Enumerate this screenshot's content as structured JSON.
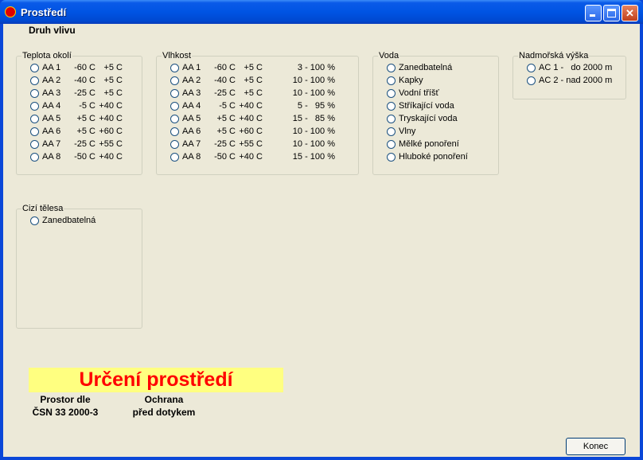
{
  "window": {
    "title": "Prostředí"
  },
  "section_heading": "Druh vlivu",
  "teplota": {
    "legend": "Teplota okolí",
    "items": [
      {
        "code": "AA 1",
        "lo": "-60 C",
        "hi": "+5 C"
      },
      {
        "code": "AA 2",
        "lo": "-40 C",
        "hi": "+5 C"
      },
      {
        "code": "AA 3",
        "lo": "-25 C",
        "hi": "+5 C"
      },
      {
        "code": "AA 4",
        "lo": "-5 C",
        "hi": "+40 C"
      },
      {
        "code": "AA 5",
        "lo": "+5 C",
        "hi": "+40 C"
      },
      {
        "code": "AA 6",
        "lo": "+5 C",
        "hi": "+60 C"
      },
      {
        "code": "AA 7",
        "lo": "-25 C",
        "hi": "+55 C"
      },
      {
        "code": "AA 8",
        "lo": "-50 C",
        "hi": "+40 C"
      }
    ]
  },
  "vlhkost": {
    "legend": "Vlhkost",
    "items": [
      {
        "code": "AA 1",
        "lo": "-60 C",
        "hi": "+5 C",
        "hum": "3 - 100 %"
      },
      {
        "code": "AA 2",
        "lo": "-40 C",
        "hi": "+5 C",
        "hum": "10 - 100 %"
      },
      {
        "code": "AA 3",
        "lo": "-25 C",
        "hi": "+5 C",
        "hum": "10 - 100 %"
      },
      {
        "code": "AA 4",
        "lo": "-5 C",
        "hi": "+40 C",
        "hum": "5 -   95 %"
      },
      {
        "code": "AA 5",
        "lo": "+5 C",
        "hi": "+40 C",
        "hum": "15 -   85 %"
      },
      {
        "code": "AA 6",
        "lo": "+5 C",
        "hi": "+60 C",
        "hum": "10 - 100 %"
      },
      {
        "code": "AA 7",
        "lo": "-25 C",
        "hi": "+55 C",
        "hum": "10 - 100 %"
      },
      {
        "code": "AA 8",
        "lo": "-50 C",
        "hi": "+40 C",
        "hum": "15 - 100 %"
      }
    ]
  },
  "voda": {
    "legend": "Voda",
    "items": [
      "Zanedbatelná",
      "Kapky",
      "Vodní tříšť",
      "Stříkající voda",
      "Tryskající voda",
      "Vlny",
      "Mělké ponoření",
      "Hluboké ponoření"
    ]
  },
  "vyska": {
    "legend": "Nadmořská výška",
    "items": [
      "AC 1 -   do 2000 m",
      "AC 2 - nad 2000 m"
    ]
  },
  "cizi": {
    "legend": "Cizí tělesa",
    "items": [
      "Zanedbatelná"
    ]
  },
  "banner": "Určení prostředí",
  "captions": {
    "prostor": [
      "Prostor dle",
      "ČSN 33 2000-3"
    ],
    "ochrana": [
      "Ochrana",
      "před dotykem"
    ]
  },
  "buttons": {
    "konec": "Konec"
  }
}
